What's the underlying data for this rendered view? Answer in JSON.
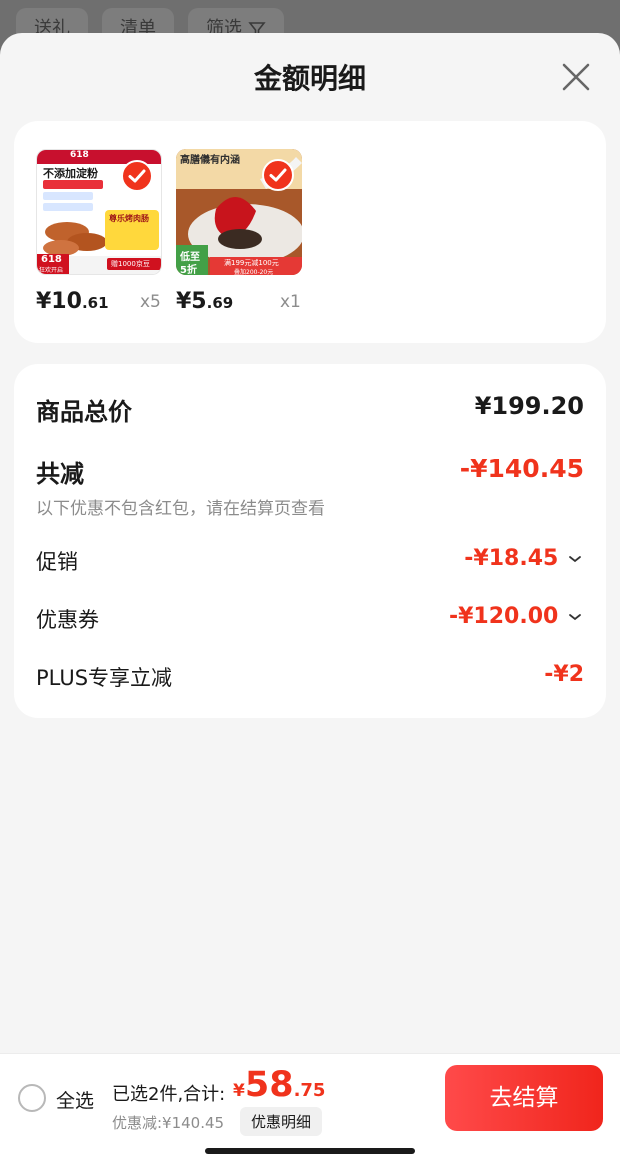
{
  "background": {
    "tabs": [
      "送礼",
      "清单",
      "筛选"
    ]
  },
  "sheet": {
    "title": "金额明细"
  },
  "products": [
    {
      "price_int": "¥10",
      "price_dec": ".61",
      "qty": "x5",
      "image": {
        "headline": "不添加淀粉",
        "badge_top": "618",
        "badge_bottom": "618",
        "badge_bottom_sub": "狂欢开启",
        "tag": "尊乐烤肉肠",
        "promo": "赠1000京豆"
      }
    },
    {
      "price_int": "¥5",
      "price_dec": ".69",
      "qty": "x1",
      "image": {
        "headline": "高膳儀有内涵",
        "badge": "低至",
        "badge_sub": "5折",
        "promo": "满199元减100元",
        "promo_sub": "叠加200-20元"
      }
    }
  ],
  "summary": {
    "total_label": "商品总价",
    "total_value": "¥199.20",
    "reduce_label": "共减",
    "reduce_value": "-¥140.45",
    "note": "以下优惠不包含红包，请在结算页查看",
    "items": [
      {
        "label": "促销",
        "value": "-¥18.45",
        "expandable": true
      },
      {
        "label": "优惠券",
        "value": "-¥120.00",
        "expandable": true
      },
      {
        "label": "PLUS专享立减",
        "value": "-¥2",
        "expandable": false
      }
    ]
  },
  "bottom_bar": {
    "select_all": "全选",
    "selected_text": "已选2件,合计:",
    "total_sym": "¥",
    "total_int": "58",
    "total_dec": ".75",
    "discount_text": "优惠减:¥140.45",
    "detail_button": "优惠明细",
    "checkout_button": "去结算"
  },
  "colors": {
    "accent": "#f0331c",
    "checkout_gradient_start": "#ff4a4a",
    "checkout_gradient_end": "#f0251c"
  }
}
